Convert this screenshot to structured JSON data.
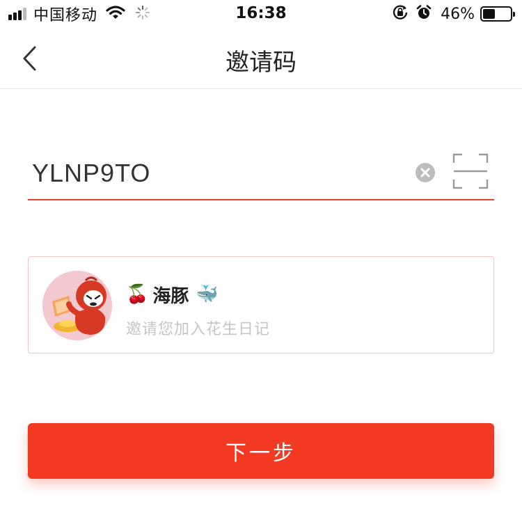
{
  "status_bar": {
    "carrier": "中国移动",
    "time": "16:38",
    "battery_percent": "46%",
    "battery_level": 0.46,
    "icons": [
      "signal-icon",
      "wifi-icon",
      "loading-icon",
      "orientation-lock-icon",
      "alarm-icon",
      "battery-icon"
    ]
  },
  "nav": {
    "title": "邀请码",
    "back_icon": "chevron-left-icon"
  },
  "invite_code": {
    "value": "YLNP9TO",
    "clear_icon": "clear-icon",
    "scan_icon": "scan-icon",
    "underline_color": "#e8412a"
  },
  "inviter": {
    "name": "海豚",
    "subtitle": "邀请您加入花生日记",
    "prefix_emoji": "🍒",
    "suffix_emoji": "🐳",
    "avatar_icon": "avatar"
  },
  "next_button": {
    "label": "下一步",
    "color": "#f23a22"
  }
}
